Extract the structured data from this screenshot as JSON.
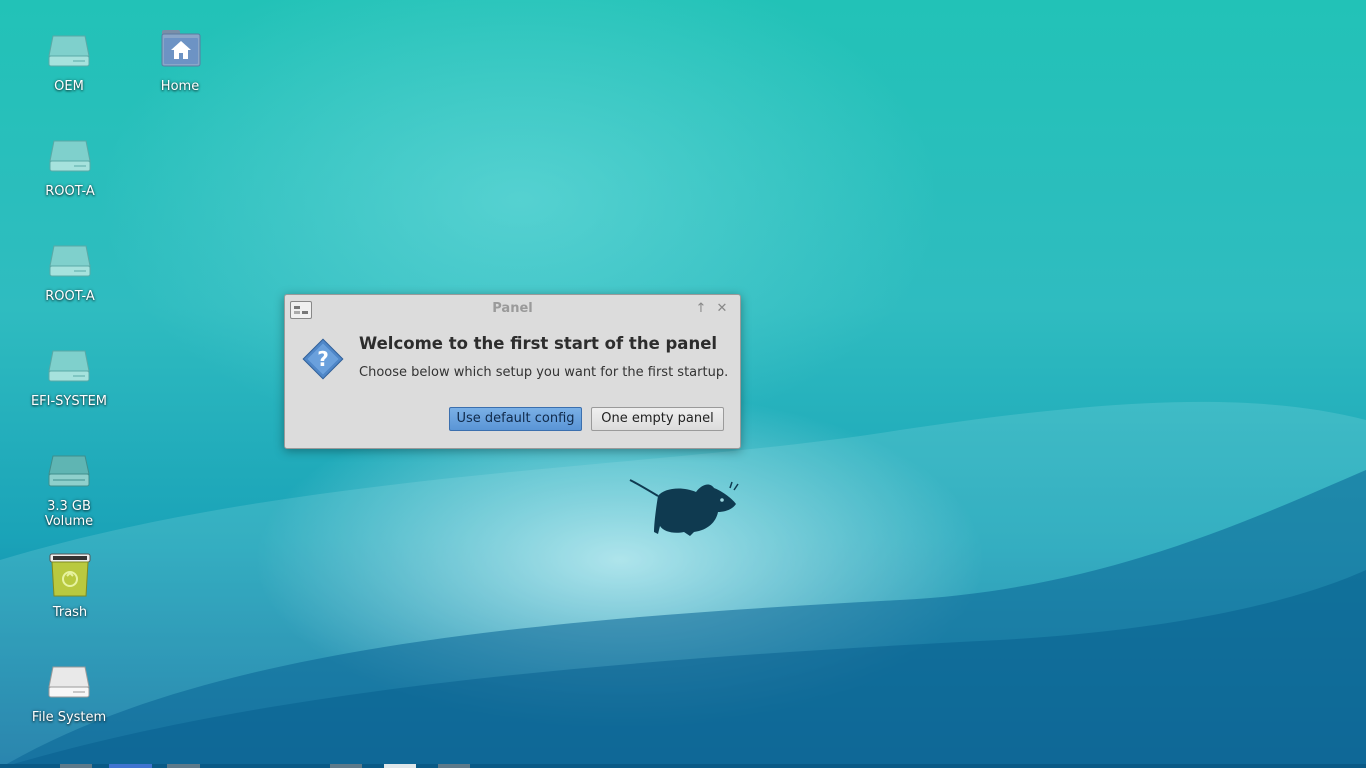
{
  "desktop": {
    "icons": [
      {
        "label": "OEM",
        "icon": "drive-icon"
      },
      {
        "label": "Home",
        "icon": "home-folder-icon"
      },
      {
        "label": "ROOT-A",
        "icon": "drive-icon"
      },
      {
        "label": "ROOT-A",
        "icon": "drive-icon"
      },
      {
        "label": "EFI-SYSTEM",
        "icon": "drive-icon"
      },
      {
        "label": "3.3 GB\nVolume",
        "icon": "drive-icon"
      },
      {
        "label": "Trash",
        "icon": "trash-icon"
      },
      {
        "label": "File System",
        "icon": "drive-icon"
      }
    ]
  },
  "dialog": {
    "title": "Panel",
    "heading": "Welcome to the first start of the panel",
    "message": "Choose below which setup you want for the first startup.",
    "buttons": {
      "default_config": "Use default config",
      "empty_panel": "One empty panel"
    }
  },
  "colors": {
    "accent": "#5a95d6",
    "desktop_top": "#22c2b7",
    "desktop_bottom": "#0d6fa0"
  }
}
